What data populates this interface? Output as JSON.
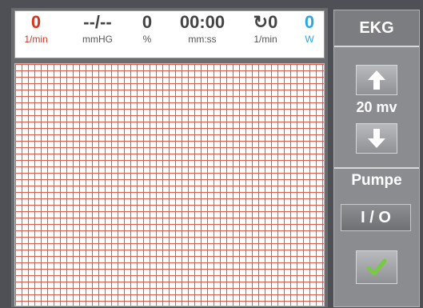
{
  "readouts": [
    {
      "value": "0",
      "unit": "1/min",
      "color": "red"
    },
    {
      "value": "--/--",
      "unit": "mmHG",
      "color": "gray"
    },
    {
      "value": "0",
      "unit": "%",
      "color": "gray"
    },
    {
      "value": "00:00",
      "unit": "mm:ss",
      "color": "gray"
    },
    {
      "value": "↻0",
      "unit": "1/min",
      "color": "gray"
    },
    {
      "value": "0",
      "unit": "W",
      "color": "blue"
    }
  ],
  "panel": {
    "title": "EKG",
    "amplitude": "20 mv",
    "pump_label": "Pumpe",
    "toggle_label": "I / O"
  },
  "colors": {
    "grid_line": "#e65a4e",
    "heart_rate": "#d8321e",
    "power": "#2aa7e0",
    "confirm": "#7ac943"
  },
  "icons": [
    "arrow-up-icon",
    "arrow-down-icon",
    "checkmark-icon"
  ]
}
